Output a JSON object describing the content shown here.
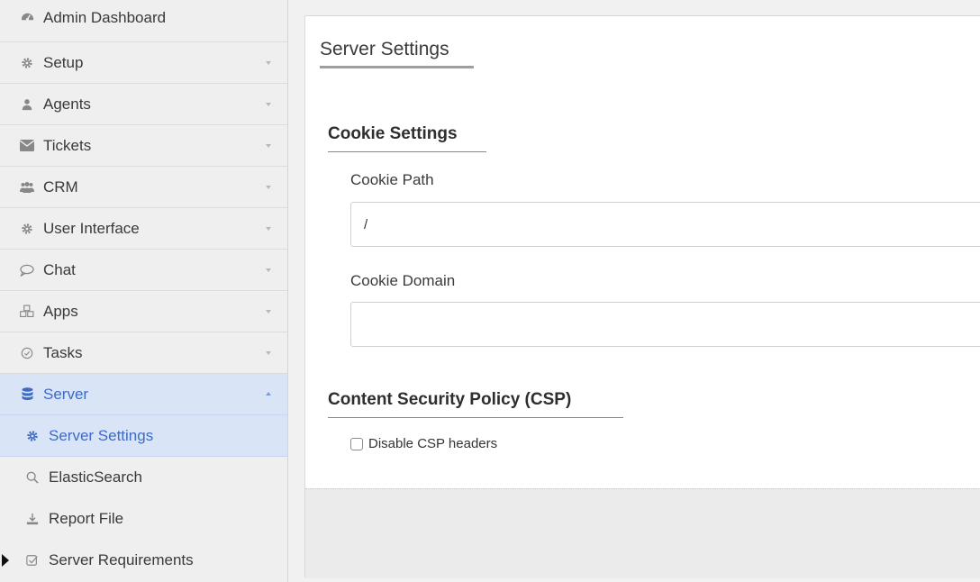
{
  "sidebar": {
    "items": [
      {
        "label": "Admin Dashboard",
        "icon": "dashboard-icon"
      },
      {
        "label": "Setup",
        "icon": "gear-icon"
      },
      {
        "label": "Agents",
        "icon": "user-icon"
      },
      {
        "label": "Tickets",
        "icon": "envelope-icon"
      },
      {
        "label": "CRM",
        "icon": "users-icon"
      },
      {
        "label": "User Interface",
        "icon": "gear-icon"
      },
      {
        "label": "Chat",
        "icon": "chat-icon"
      },
      {
        "label": "Apps",
        "icon": "cubes-icon"
      },
      {
        "label": "Tasks",
        "icon": "check-circle-icon"
      },
      {
        "label": "Server",
        "icon": "database-icon"
      }
    ],
    "subitems": [
      {
        "label": "Server Settings",
        "icon": "gear-icon"
      },
      {
        "label": "ElasticSearch",
        "icon": "search-icon"
      },
      {
        "label": "Report File",
        "icon": "download-icon"
      },
      {
        "label": "Server Requirements",
        "icon": "checkbox-icon"
      }
    ],
    "active_item": "Server",
    "active_subitem": "Server Settings"
  },
  "main": {
    "title": "Server Settings",
    "sections": {
      "cookie": {
        "title": "Cookie Settings",
        "path_label": "Cookie Path",
        "path_value": "/",
        "domain_label": "Cookie Domain",
        "domain_value": ""
      },
      "csp": {
        "title": "Content Security Policy (CSP)",
        "disable_label": "Disable CSP headers",
        "disable_checked": false
      }
    }
  },
  "colors": {
    "accent": "#3f6bc4",
    "active_bg": "#d9e4f7",
    "sidebar_bg": "#efefef"
  }
}
